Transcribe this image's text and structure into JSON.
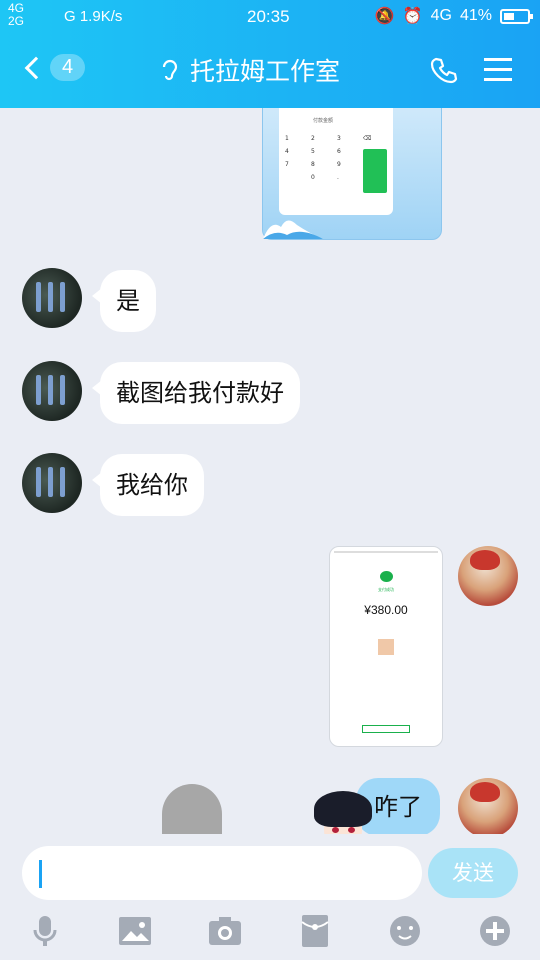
{
  "status_bar": {
    "network_left": "4G\n2G",
    "signal_text": "G",
    "speed": "1.9K/s",
    "time": "20:35",
    "network_right": "4G",
    "battery": "41%"
  },
  "nav": {
    "back_count": "4",
    "title": "托拉姆工作室"
  },
  "messages": [
    {
      "side": "left",
      "text": "是"
    },
    {
      "side": "left",
      "text": "截图给我付款好"
    },
    {
      "side": "left",
      "text": "我给你"
    },
    {
      "side": "right",
      "text": "咋了"
    }
  ],
  "payment_screenshot": {
    "status": "支付成功",
    "amount": "¥380.00"
  },
  "input": {
    "placeholder": "",
    "send_label": "发送"
  },
  "tools": [
    "microphone-icon",
    "image-icon",
    "camera-icon",
    "red-packet-icon",
    "emoji-icon",
    "plus-icon"
  ],
  "colors": {
    "header": "#1aa3f4",
    "bubble_right": "#9fd8f8",
    "background": "#eaedf4"
  }
}
